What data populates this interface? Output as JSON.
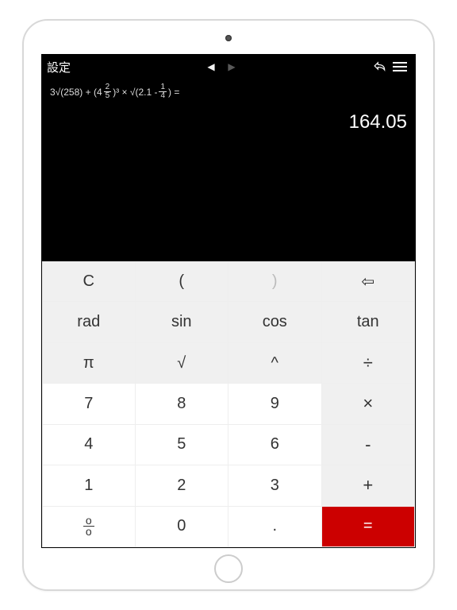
{
  "topbar": {
    "settings": "設定"
  },
  "display": {
    "expr_parts": {
      "p1": "3√(258) + (4",
      "f1n": "2",
      "f1d": "5",
      "p2": ")³ × √(2.1 - ",
      "f2n": "1",
      "f2d": "4",
      "p3": ") ="
    },
    "result": "164.05"
  },
  "keys": {
    "r1": [
      "C",
      "(",
      ")",
      "⇦"
    ],
    "r2": [
      "rad",
      "sin",
      "cos",
      "tan"
    ],
    "r3": [
      "π",
      "√",
      "^",
      "÷"
    ],
    "r4": [
      "7",
      "8",
      "9",
      "×"
    ],
    "r5": [
      "4",
      "5",
      "6",
      "-"
    ],
    "r6": [
      "1",
      "2",
      "3",
      "+"
    ],
    "r7": [
      "",
      "0",
      ".",
      "="
    ]
  },
  "fraction_key": {
    "top": "o",
    "bot": "o"
  }
}
